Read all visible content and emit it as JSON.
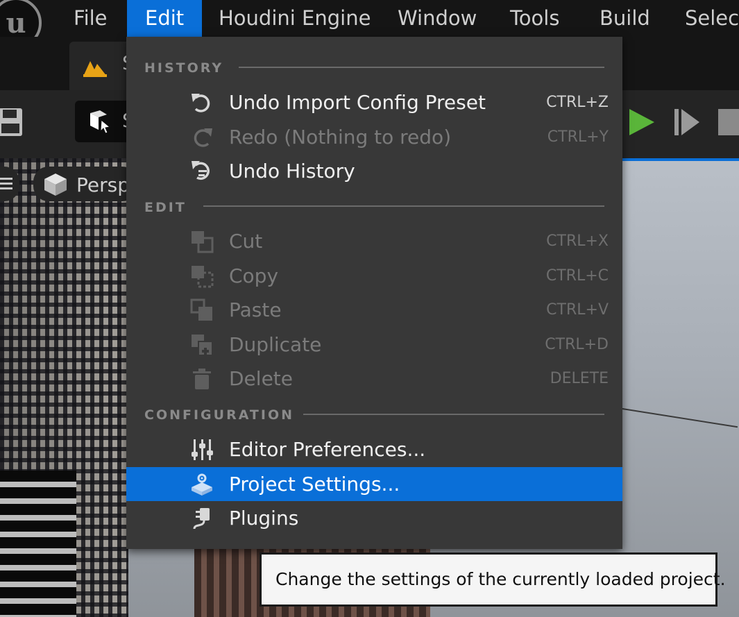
{
  "menubar": {
    "items": [
      {
        "label": "File"
      },
      {
        "label": "Edit"
      },
      {
        "label": "Houdini Engine"
      },
      {
        "label": "Window"
      },
      {
        "label": "Tools"
      },
      {
        "label": "Build"
      },
      {
        "label": "Select"
      }
    ],
    "active_index": 1
  },
  "tabs": [
    {
      "label": "S"
    }
  ],
  "toolbar": {
    "mode_label": "S"
  },
  "viewport": {
    "view_mode_label": "Persp"
  },
  "edit_menu": {
    "sections": [
      {
        "header": "HISTORY"
      },
      {
        "header": "EDIT"
      },
      {
        "header": "CONFIGURATION"
      }
    ],
    "history": [
      {
        "label": "Undo Import Config Preset",
        "shortcut": "CTRL+Z",
        "enabled": true,
        "icon": "undo-icon"
      },
      {
        "label": "Redo (Nothing to redo)",
        "shortcut": "CTRL+Y",
        "enabled": false,
        "icon": "redo-icon"
      },
      {
        "label": "Undo History",
        "shortcut": "",
        "enabled": true,
        "icon": "undo-history-icon"
      }
    ],
    "edit": [
      {
        "label": "Cut",
        "shortcut": "CTRL+X",
        "enabled": false,
        "icon": "cut-icon"
      },
      {
        "label": "Copy",
        "shortcut": "CTRL+C",
        "enabled": false,
        "icon": "copy-icon"
      },
      {
        "label": "Paste",
        "shortcut": "CTRL+V",
        "enabled": false,
        "icon": "paste-icon"
      },
      {
        "label": "Duplicate",
        "shortcut": "CTRL+D",
        "enabled": false,
        "icon": "duplicate-icon"
      },
      {
        "label": "Delete",
        "shortcut": "DELETE",
        "enabled": false,
        "icon": "trash-icon"
      }
    ],
    "configuration": [
      {
        "label": "Editor Preferences...",
        "enabled": true,
        "icon": "sliders-icon"
      },
      {
        "label": "Project Settings...",
        "enabled": true,
        "highlighted": true,
        "icon": "project-settings-icon"
      },
      {
        "label": "Plugins",
        "enabled": true,
        "icon": "plug-icon"
      }
    ]
  },
  "tooltip": {
    "text": "Change the settings of the currently loaded project."
  },
  "colors": {
    "accent": "#0a6fd8",
    "menu_bg": "#383838",
    "play_green": "#5ab53a"
  }
}
